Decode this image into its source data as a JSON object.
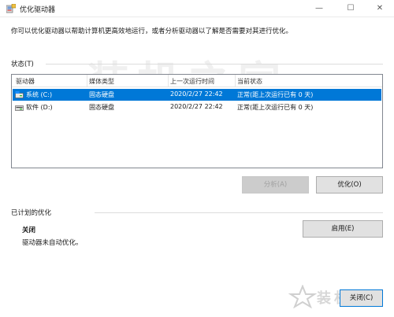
{
  "window": {
    "title": "优化驱动器",
    "controls": {
      "minimize": "—",
      "maximize": "☐",
      "close": "✕"
    }
  },
  "description": "你可以优化驱动器以帮助计算机更高效地运行，或者分析驱动器以了解是否需要对其进行优化。",
  "status": {
    "label": "状态(T)",
    "columns": [
      "驱动器",
      "媒体类型",
      "上一次运行时间",
      "当前状态"
    ],
    "rows": [
      {
        "drive": "系统 (C:)",
        "media": "固态硬盘",
        "last_run": "2020/2/27 22:42",
        "state": "正常(距上次运行已有 0 天)",
        "selected": true
      },
      {
        "drive": "软件 (D:)",
        "media": "固态硬盘",
        "last_run": "2020/2/27 22:42",
        "state": "正常(距上次运行已有 0 天)",
        "selected": false
      }
    ]
  },
  "buttons": {
    "analyze": "分析(A)",
    "optimize": "优化(O)",
    "enable": "启用(E)",
    "close": "关闭(C)"
  },
  "scheduled": {
    "label": "已计划的优化",
    "state": "关闭",
    "detail": "驱动器未自动优化。"
  },
  "watermark": {
    "main": "装机之家",
    "corner": "装机之家"
  },
  "colors": {
    "selection": "#0078d7",
    "button_face": "#e1e1e1",
    "focus_border": "#0078d7"
  }
}
